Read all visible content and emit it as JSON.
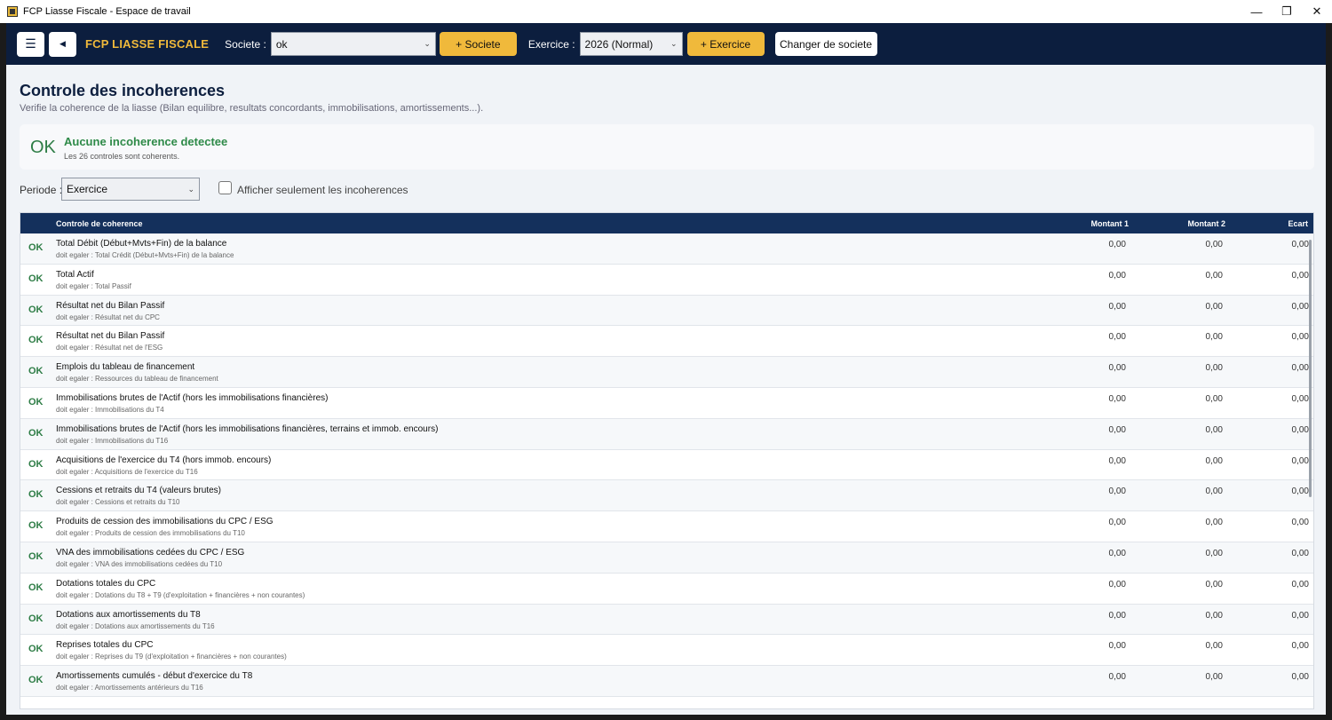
{
  "window": {
    "title": "FCP Liasse Fiscale - Espace de travail"
  },
  "appbar": {
    "brand": "FCP LIASSE FISCALE",
    "societe_label": "Societe :",
    "societe_value": "ok",
    "add_societe": "+ Societe",
    "exercice_label": "Exercice :",
    "exercice_value": "2026 (Normal)",
    "add_exercice": "+ Exercice",
    "change_societe": "Changer de societe"
  },
  "page": {
    "title": "Controle des incoherences",
    "subtitle": "Verifie la coherence de la liasse (Bilan equilibre, resultats concordants, immobilisations, amortissements...)."
  },
  "status": {
    "icon": "OK",
    "title": "Aucune incoherence detectee",
    "subtitle": "Les 26 controles sont coherents.",
    "color": "#2e8a48"
  },
  "filters": {
    "periode_label": "Periode :",
    "periode_value": "Exercice",
    "only_incoherences_label": "Afficher seulement les incoherences",
    "only_incoherences_checked": false
  },
  "table": {
    "headers": {
      "control": "Controle de coherence",
      "m1": "Montant 1",
      "m2": "Montant 2",
      "ecart": "Ecart"
    },
    "rows": [
      {
        "status": "OK",
        "title": "Total Débit (Début+Mvts+Fin) de la balance",
        "sub": "doit egaler : Total Crédit (Début+Mvts+Fin) de la balance",
        "m1": "0,00",
        "m2": "0,00",
        "ecart": "0,00"
      },
      {
        "status": "OK",
        "title": "Total Actif",
        "sub": "doit egaler : Total Passif",
        "m1": "0,00",
        "m2": "0,00",
        "ecart": "0,00"
      },
      {
        "status": "OK",
        "title": "Résultat net du Bilan Passif",
        "sub": "doit egaler : Résultat net du CPC",
        "m1": "0,00",
        "m2": "0,00",
        "ecart": "0,00"
      },
      {
        "status": "OK",
        "title": "Résultat net du Bilan Passif",
        "sub": "doit egaler : Résultat net de l'ESG",
        "m1": "0,00",
        "m2": "0,00",
        "ecart": "0,00"
      },
      {
        "status": "OK",
        "title": "Emplois du tableau de financement",
        "sub": "doit egaler : Ressources du tableau de financement",
        "m1": "0,00",
        "m2": "0,00",
        "ecart": "0,00"
      },
      {
        "status": "OK",
        "title": "Immobilisations brutes de l'Actif (hors les immobilisations financières)",
        "sub": "doit egaler : Immobilisations du T4",
        "m1": "0,00",
        "m2": "0,00",
        "ecart": "0,00"
      },
      {
        "status": "OK",
        "title": "Immobilisations brutes de l'Actif (hors les immobilisations financières, terrains et immob. encours)",
        "sub": "doit egaler : Immobilisations du T16",
        "m1": "0,00",
        "m2": "0,00",
        "ecart": "0,00"
      },
      {
        "status": "OK",
        "title": "Acquisitions de l'exercice du T4 (hors immob. encours)",
        "sub": "doit egaler : Acquisitions de l'exercice du T16",
        "m1": "0,00",
        "m2": "0,00",
        "ecart": "0,00"
      },
      {
        "status": "OK",
        "title": "Cessions et retraits du T4 (valeurs brutes)",
        "sub": "doit egaler : Cessions et retraits du T10",
        "m1": "0,00",
        "m2": "0,00",
        "ecart": "0,00"
      },
      {
        "status": "OK",
        "title": "Produits de cession des immobilisations du CPC / ESG",
        "sub": "doit egaler : Produits de cession des immobilisations du T10",
        "m1": "0,00",
        "m2": "0,00",
        "ecart": "0,00"
      },
      {
        "status": "OK",
        "title": "VNA des immobilisations cedées du CPC / ESG",
        "sub": "doit egaler : VNA des immobilisations cedées du T10",
        "m1": "0,00",
        "m2": "0,00",
        "ecart": "0,00"
      },
      {
        "status": "OK",
        "title": "Dotations totales du CPC",
        "sub": "doit egaler : Dotations du T8 + T9 (d'exploitation + financières + non courantes)",
        "m1": "0,00",
        "m2": "0,00",
        "ecart": "0,00"
      },
      {
        "status": "OK",
        "title": "Dotations aux amortissements du T8",
        "sub": "doit egaler : Dotations aux amortissements du T16",
        "m1": "0,00",
        "m2": "0,00",
        "ecart": "0,00"
      },
      {
        "status": "OK",
        "title": "Reprises totales du CPC",
        "sub": "doit egaler : Reprises du T9 (d'exploitation + financières + non courantes)",
        "m1": "0,00",
        "m2": "0,00",
        "ecart": "0,00"
      },
      {
        "status": "OK",
        "title": "Amortissements cumulés - début d'exercice du T8",
        "sub": "doit egaler : Amortissements antérieurs du T16",
        "m1": "0,00",
        "m2": "0,00",
        "ecart": "0,00"
      }
    ]
  }
}
